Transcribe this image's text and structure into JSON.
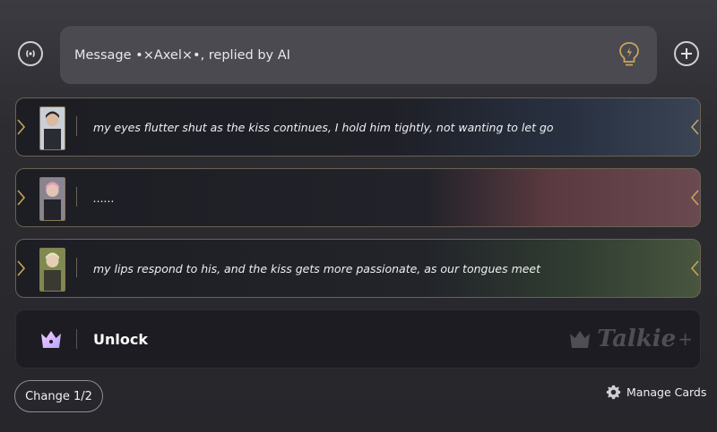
{
  "input": {
    "placeholder": "Message •×Axel×•, replied by AI"
  },
  "icons": {
    "voice": "voice-wave-icon",
    "hint": "lightbulb-icon",
    "add": "plus-circle-icon",
    "unlock": "crown-icon",
    "settings": "gear-icon"
  },
  "cards": [
    {
      "text": "my eyes flutter shut as the kiss continues, I hold him tightly, not wanting to let go"
    },
    {
      "text": "......"
    },
    {
      "text": "my lips respond to his, and the kiss gets more passionate, as our tongues meet"
    }
  ],
  "unlock": {
    "label": "Unlock",
    "watermark": "Talkie",
    "watermark_plus": "+"
  },
  "footer": {
    "change_label": "Change 1/2",
    "manage_label": "Manage Cards"
  },
  "colors": {
    "accent_gold": "#c9a45a",
    "background": "#2c2c31",
    "card_bg": "#1d1e24"
  }
}
